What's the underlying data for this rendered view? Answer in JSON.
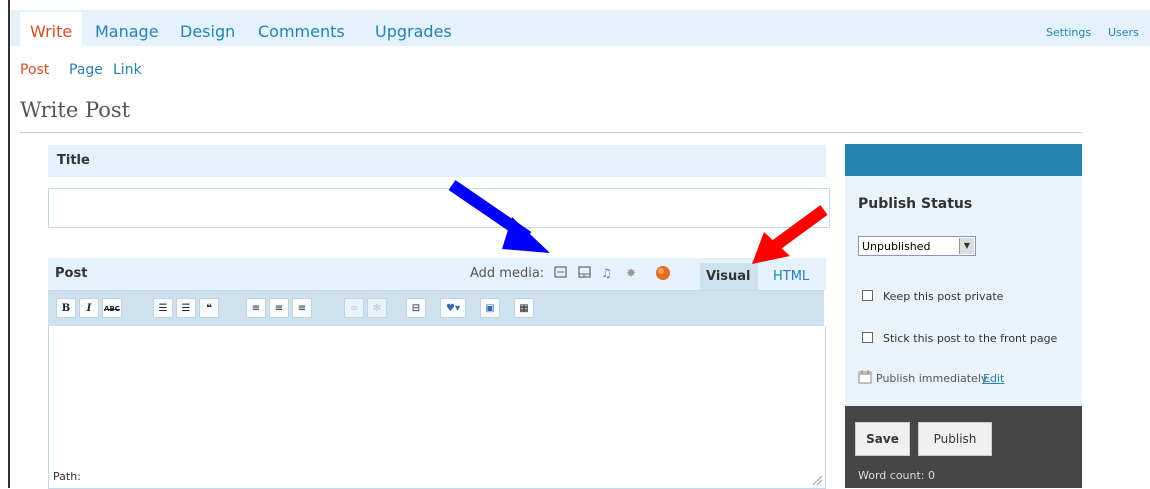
{
  "topnav": {
    "items": [
      "Write",
      "Manage",
      "Design",
      "Comments",
      "Upgrades"
    ],
    "right_links": [
      "Settings",
      "Users"
    ]
  },
  "subnav": {
    "items": [
      "Post",
      "Page",
      "Link"
    ]
  },
  "page_title": "Write Post",
  "title_box": {
    "label": "Title",
    "value": ""
  },
  "post_box": {
    "label": "Post",
    "add_media_label": "Add media:",
    "tabs": [
      "Visual",
      "HTML"
    ],
    "toolbar": [
      "B",
      "I",
      "ABC"
    ],
    "path_label": "Path:"
  },
  "sidebar": {
    "publish_status_label": "Publish Status",
    "status_value": "Unpublished",
    "private_label": "Keep this post private",
    "sticky_label": "Stick this post to the front page",
    "publish_immediately": "Publish immediately",
    "edit_link": "Edit",
    "save_label": "Save",
    "publish_label": "Publish",
    "word_count": "Word count: 0"
  },
  "colors": {
    "accent_orange": "#d54e21",
    "link_blue": "#2583ad",
    "sidebar_blue": "#2683ae",
    "annotation_blue": "#0000ff",
    "annotation_red": "#ff0000"
  }
}
